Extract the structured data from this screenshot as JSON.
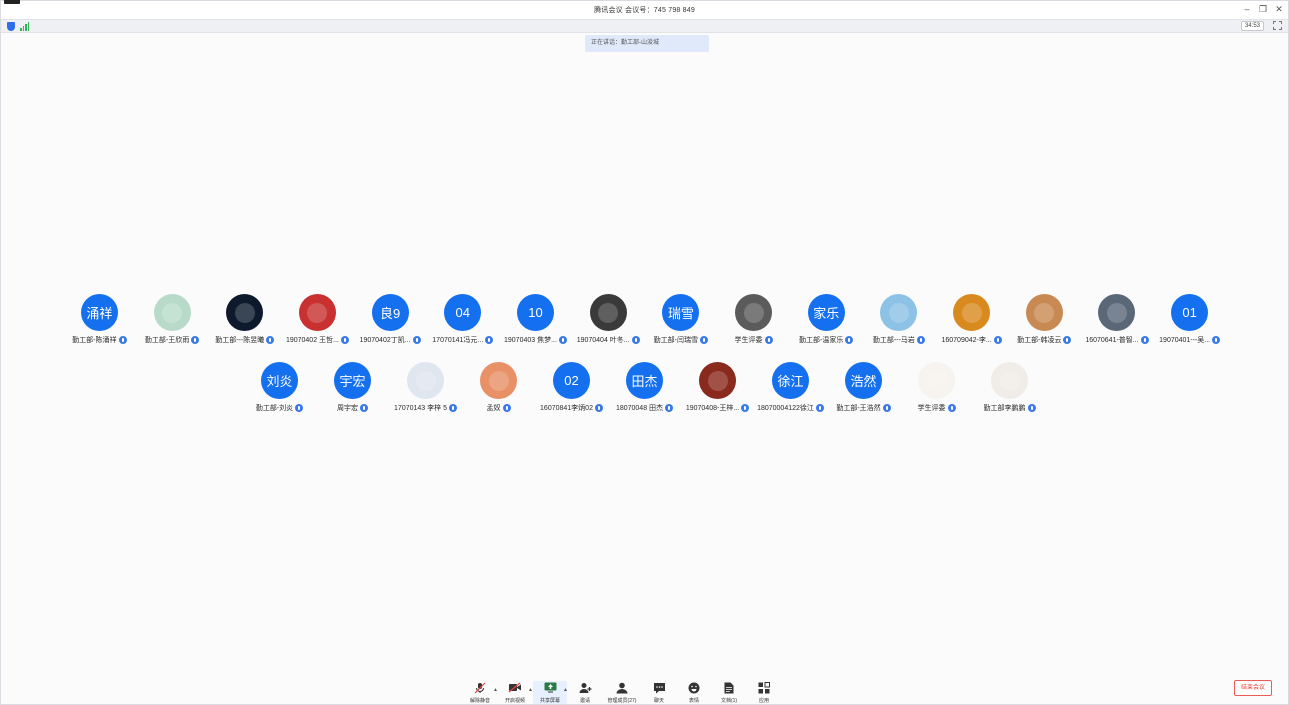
{
  "window": {
    "title": "腾讯会议 会议号：745 798 849",
    "controls": [
      "minimize",
      "restore",
      "close"
    ]
  },
  "infobar": {
    "timer": "34:53",
    "icons": [
      "shield-icon",
      "signal-icon",
      "fullscreen-icon"
    ]
  },
  "speaking": {
    "label": "正在讲话：勤工部-山浚城"
  },
  "participants_row1": [
    {
      "avatar_text": "涌祥",
      "name": "勤工部-陈涌祥",
      "color": "#1570ef"
    },
    {
      "avatar_text": "",
      "name": "勤工部-王欣雨",
      "color": "#b8dbc9",
      "image": "carrot"
    },
    {
      "avatar_text": "",
      "name": "勤工部---陈昱曦",
      "color": "#0d1a2d",
      "image": "glow"
    },
    {
      "avatar_text": "",
      "name": "19070402 王哲...",
      "color": "#c8312f",
      "image": "red-figure"
    },
    {
      "avatar_text": "良9",
      "name": "19070402丁凯...",
      "color": "#1570ef"
    },
    {
      "avatar_text": "04",
      "name": "17070141冯元...",
      "color": "#1570ef"
    },
    {
      "avatar_text": "10",
      "name": "19070403 焦梦...",
      "color": "#1570ef"
    },
    {
      "avatar_text": "",
      "name": "19070404 叶冬...",
      "color": "#3a3a3a",
      "image": "bw-person"
    },
    {
      "avatar_text": "瑞雪",
      "name": "勤工部-闫瑞雪",
      "color": "#1570ef"
    },
    {
      "avatar_text": "",
      "name": "学生评委",
      "color": "#5b5b5b",
      "image": "gray-photo"
    },
    {
      "avatar_text": "家乐",
      "name": "勤工部-温家乐",
      "color": "#1570ef"
    },
    {
      "avatar_text": "",
      "name": "勤工部---马岩",
      "color": "#8cc2e6",
      "image": "sky"
    },
    {
      "avatar_text": "",
      "name": "160709042-李...",
      "color": "#d98a1f",
      "image": "cartoon"
    },
    {
      "avatar_text": "",
      "name": "勤工部-韩凌云",
      "color": "#c88a52",
      "image": "dog"
    },
    {
      "avatar_text": "",
      "name": "16070641-普智...",
      "color": "#596777",
      "image": "landscape"
    },
    {
      "avatar_text": "01",
      "name": "19070401---吴...",
      "color": "#1570ef"
    }
  ],
  "participants_row2": [
    {
      "avatar_text": "刘炎",
      "name": "勤工部-刘炎",
      "color": "#1570ef"
    },
    {
      "avatar_text": "宇宏",
      "name": "周宇宏",
      "color": "#1570ef"
    },
    {
      "avatar_text": "",
      "name": "17070143 李梓 5",
      "color": "#dfe6ef",
      "image": "white-dog"
    },
    {
      "avatar_text": "",
      "name": "孟奴",
      "color": "#e89066",
      "image": "bear"
    },
    {
      "avatar_text": "02",
      "name": "16070841李炳02",
      "color": "#1570ef"
    },
    {
      "avatar_text": "田杰",
      "name": "18070048 田杰",
      "color": "#1570ef"
    },
    {
      "avatar_text": "",
      "name": "19070408-王梓...",
      "color": "#8a2a1e",
      "image": "athlete"
    },
    {
      "avatar_text": "徐江",
      "name": "18070004122徐江",
      "color": "#1570ef"
    },
    {
      "avatar_text": "浩然",
      "name": "勤工部-王浩然",
      "color": "#1570ef"
    },
    {
      "avatar_text": "",
      "name": "学生评委",
      "color": "#f7f3ee",
      "image": "brown-bear"
    },
    {
      "avatar_text": "",
      "name": "勤工部李鹏鹏",
      "color": "#f0ece8",
      "image": "anime-boy"
    }
  ],
  "toolbar": {
    "items": [
      {
        "label": "解除静音",
        "icon": "mic-muted-icon"
      },
      {
        "label": "开启视频",
        "icon": "camera-off-icon"
      },
      {
        "label": "共享屏幕",
        "icon": "share-screen-icon"
      },
      {
        "label": "邀请",
        "icon": "invite-icon"
      },
      {
        "label": "管理成员(27)",
        "icon": "members-icon"
      },
      {
        "label": "聊天",
        "icon": "chat-icon"
      },
      {
        "label": "表情",
        "icon": "emoji-icon"
      },
      {
        "label": "文档(1)",
        "icon": "document-icon"
      },
      {
        "label": "应用",
        "icon": "apps-icon"
      }
    ],
    "end_label": "结束会议"
  }
}
